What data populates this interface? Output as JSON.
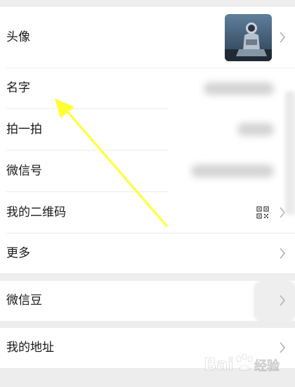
{
  "profile": {
    "avatar_label": "头像",
    "name_label": "名字",
    "pat_label": "拍一拍",
    "wechat_id_label": "微信号",
    "qrcode_label": "我的二维码",
    "more_label": "更多"
  },
  "wallet": {
    "beans_label": "微信豆"
  },
  "address": {
    "label": "我的地址"
  },
  "icons": {
    "chevron": "chevron-right-icon",
    "qrcode": "qrcode-icon"
  },
  "annotation": {
    "color": "#ffff33"
  },
  "watermark": {
    "text": "Bai 经验",
    "color": "#ffffff"
  }
}
